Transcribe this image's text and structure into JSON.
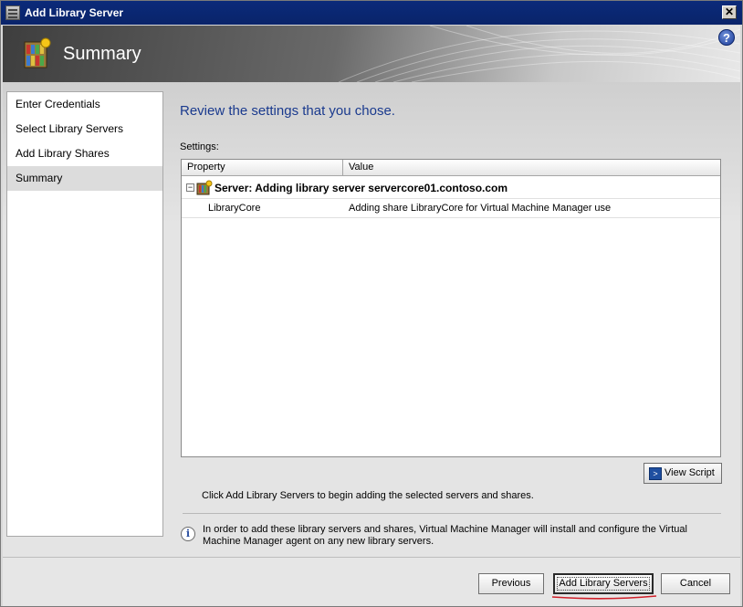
{
  "window": {
    "title": "Add Library Server",
    "close_glyph": "✕"
  },
  "header": {
    "title": "Summary",
    "help_glyph": "?",
    "icon": "library-summary-icon"
  },
  "nav": {
    "items": [
      {
        "label": "Enter Credentials"
      },
      {
        "label": "Select Library Servers"
      },
      {
        "label": "Add Library Shares"
      },
      {
        "label": "Summary",
        "active": true
      }
    ]
  },
  "main": {
    "heading": "Review the settings that you chose.",
    "settings_label": "Settings:",
    "grid": {
      "columns": [
        "Property",
        "Value"
      ],
      "group": {
        "expander": "−",
        "text": "Server: Adding library server servercore01.contoso.com"
      },
      "rows": [
        {
          "property": "LibraryCore",
          "value": "Adding share LibraryCore for Virtual Machine Manager use"
        }
      ]
    },
    "view_script_label": "View Script",
    "click_text": "Click Add Library Servers to begin adding the selected servers and shares.",
    "info_glyph": "i",
    "info_text": "In order to add these library servers and shares, Virtual Machine Manager will install and configure the Virtual Machine Manager agent on any new library servers."
  },
  "footer": {
    "previous_label": "Previous",
    "add_label": "Add Library Servers",
    "cancel_label": "Cancel"
  },
  "colors": {
    "heading": "#1a3a8e",
    "titlebar": "#0a246a",
    "annotation_underline": "#d0202a"
  }
}
